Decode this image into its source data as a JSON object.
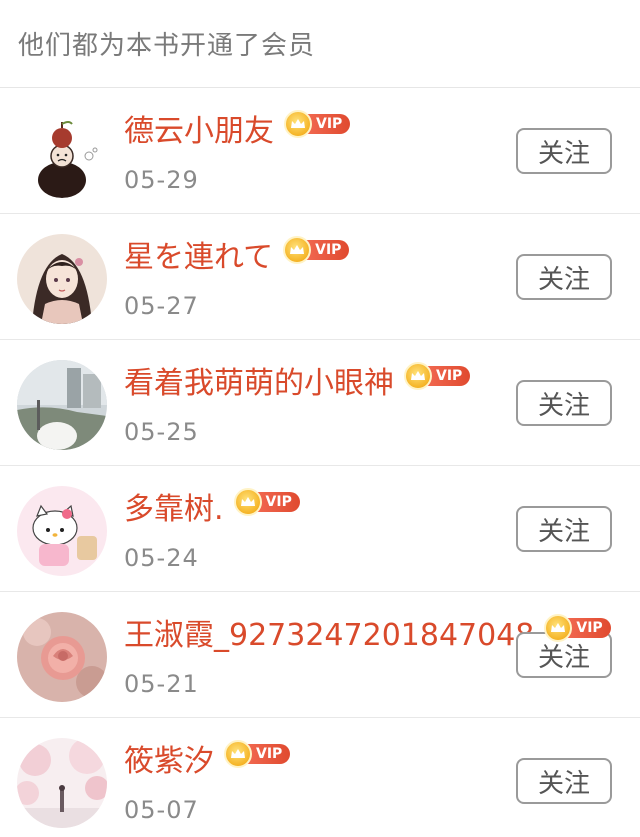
{
  "header": {
    "title": "他们都为本书开通了会员"
  },
  "vip_label": "VIP",
  "follow_label": "关注",
  "colors": {
    "name": "#d94a2b",
    "vip": "#e04a2f",
    "crown": "#f5b427"
  },
  "members": [
    {
      "name": "德云小朋友",
      "date": "05-29",
      "avatar_icon": "chibi-character-icon"
    },
    {
      "name": "星を連れて",
      "date": "05-27",
      "avatar_icon": "anime-girl-icon"
    },
    {
      "name": "看着我萌萌的小眼神",
      "date": "05-25",
      "avatar_icon": "street-photo-icon"
    },
    {
      "name": "多靠树.",
      "date": "05-24",
      "avatar_icon": "hello-kitty-icon"
    },
    {
      "name": "王淑霞_9273247201847048",
      "date": "05-21",
      "avatar_icon": "pink-rose-icon"
    },
    {
      "name": "筱紫汐",
      "date": "05-07",
      "avatar_icon": "cherry-blossom-icon"
    }
  ]
}
